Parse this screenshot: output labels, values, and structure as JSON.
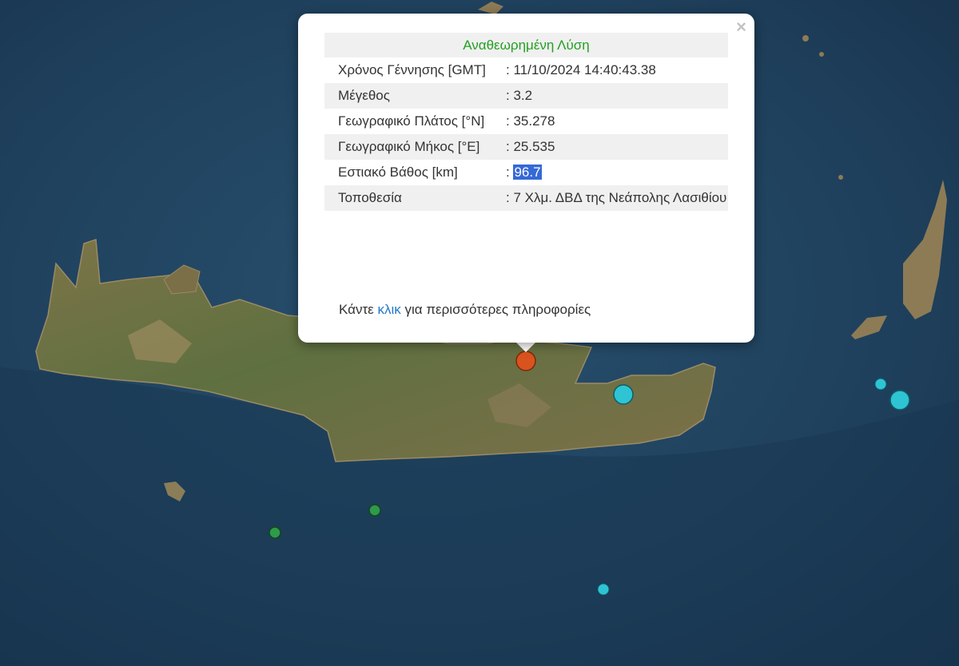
{
  "popup": {
    "title": "Αναθεωρημένη Λύση",
    "close_glyph": "×",
    "rows": [
      {
        "label": "Χρόνος Γέννησης [GMT]",
        "value": ": 11/10/2024 14:40:43.38"
      },
      {
        "label": "Μέγεθος",
        "value": ": 3.2"
      },
      {
        "label": "Γεωγραφικό Πλάτος [°N]",
        "value": ": 35.278"
      },
      {
        "label": "Γεωγραφικό Μήκος [°E]",
        "value": ": 25.535"
      },
      {
        "label": "Εστιακό Βάθος [km]",
        "value_prefix": ": ",
        "value_selected": "96.7"
      },
      {
        "label": "Τοποθεσία",
        "value": ": 7 Χλμ. ΔΒΔ της Νεάπολης Λασιθίου"
      }
    ],
    "more_prefix": "Κάντε ",
    "more_link": "κλικ",
    "more_suffix": " για περισσότερες πληροφορίες"
  },
  "colors": {
    "sea": "#1f3c55",
    "land": "#6e7a4a",
    "selected_event": "#d9531e",
    "event_cyan": "#2ec4d4",
    "event_green": "#2e9a4a",
    "title_green": "#22a022",
    "link_blue": "#2278c8",
    "selection_blue": "#3569d6"
  }
}
